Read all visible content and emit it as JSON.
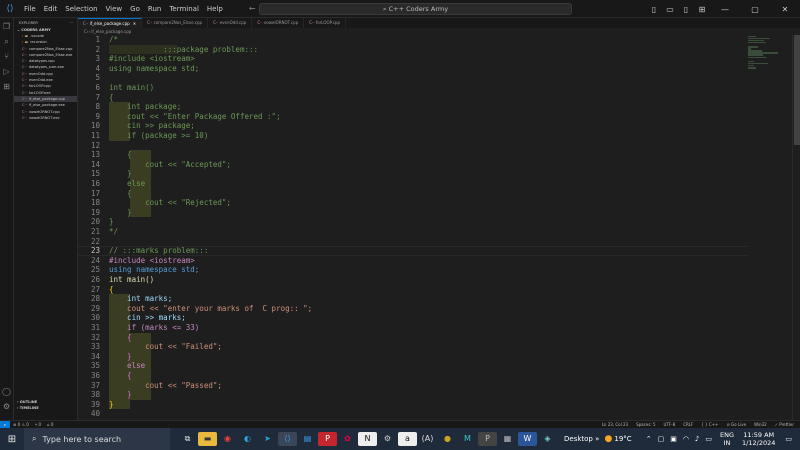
{
  "window": {
    "title": "C++ Coders Army",
    "menu": [
      "File",
      "Edit",
      "Selection",
      "View",
      "Go",
      "Run",
      "Terminal",
      "Help"
    ]
  },
  "sidebar": {
    "header": "EXPLORER",
    "folder": "CODERS ARMY",
    "items": [
      {
        "label": ".vscode",
        "type": "dir"
      },
      {
        "label": "recursion",
        "type": "dir"
      },
      {
        "label": "compare2Nos_Elsse.cpp",
        "type": "file"
      },
      {
        "label": "compare2Nos_Elsse.exe",
        "type": "file"
      },
      {
        "label": "datatypes.cpp",
        "type": "file"
      },
      {
        "label": "datatypes_sum.exe",
        "type": "file"
      },
      {
        "label": "evenOdd.cpp",
        "type": "file"
      },
      {
        "label": "evenOdd.exe",
        "type": "file"
      },
      {
        "label": "forLOOP.cpp",
        "type": "file"
      },
      {
        "label": "forLOOP.exe",
        "type": "file"
      },
      {
        "label": "if_else_package.cpp",
        "type": "file",
        "selected": true
      },
      {
        "label": "if_else_package.exe",
        "type": "file"
      },
      {
        "label": "vowelORNOT.cpp",
        "type": "file"
      },
      {
        "label": "vowelORNOT.exe",
        "type": "file"
      }
    ],
    "bottom": [
      "OUTLINE",
      "TIMELINE"
    ]
  },
  "tabs": [
    {
      "label": "if_else_package.cpp",
      "active": true
    },
    {
      "label": "compare2Nos_Elsse.cpp",
      "active": false
    },
    {
      "label": "evenOdd.cpp",
      "active": false
    },
    {
      "label": "vowelORNOT.cpp",
      "active": false
    },
    {
      "label": "forLOOP.cpp",
      "active": false
    }
  ],
  "breadcrumb": "if_else_package.cpp",
  "editor": {
    "current_line": 23,
    "lines": [
      {
        "n": 1,
        "t": "/*",
        "c": "#6a9955"
      },
      {
        "n": 2,
        "t": "            :::package problem:::",
        "c": "#6a9955"
      },
      {
        "n": 3,
        "t": "#include <iostream>",
        "c": "#6a9955"
      },
      {
        "n": 4,
        "t": "using namespace std;",
        "c": "#6a9955"
      },
      {
        "n": 5,
        "t": "",
        "c": "#6a9955"
      },
      {
        "n": 6,
        "t": "int main()",
        "c": "#6a9955"
      },
      {
        "n": 7,
        "t": "{",
        "c": "#6a9955"
      },
      {
        "n": 8,
        "t": "    int package;",
        "c": "#6a9955"
      },
      {
        "n": 9,
        "t": "    cout << \"Enter Package Offered :\";",
        "c": "#6a9955"
      },
      {
        "n": 10,
        "t": "    cin >> package;",
        "c": "#6a9955"
      },
      {
        "n": 11,
        "t": "    if (package >= 10)",
        "c": "#6a9955"
      },
      {
        "n": 12,
        "t": "",
        "c": "#6a9955"
      },
      {
        "n": 13,
        "t": "    {",
        "c": "#6a9955"
      },
      {
        "n": 14,
        "t": "        cout << \"Accepted\";",
        "c": "#6a9955"
      },
      {
        "n": 15,
        "t": "    }",
        "c": "#6a9955"
      },
      {
        "n": 16,
        "t": "    else",
        "c": "#6a9955"
      },
      {
        "n": 17,
        "t": "    {",
        "c": "#6a9955"
      },
      {
        "n": 18,
        "t": "        cout << \"Rejected\";",
        "c": "#6a9955"
      },
      {
        "n": 19,
        "t": "    }",
        "c": "#6a9955"
      },
      {
        "n": 20,
        "t": "}",
        "c": "#6a9955"
      },
      {
        "n": 21,
        "t": "*/",
        "c": "#6a9955"
      },
      {
        "n": 22,
        "t": "",
        "c": "#6a9955"
      },
      {
        "n": 23,
        "t": "// :::marks problem:::",
        "c": "#6a9955"
      },
      {
        "n": 24,
        "t": "#include <iostream>",
        "c": "#c586c0"
      },
      {
        "n": 25,
        "t": "using namespace std;",
        "c": "#569cd6"
      },
      {
        "n": 26,
        "t": "int main()",
        "c": "#dcdcaa"
      },
      {
        "n": 27,
        "t": "{",
        "c": "#ffd700"
      },
      {
        "n": 28,
        "t": "    int marks;",
        "c": "#9cdcfe"
      },
      {
        "n": 29,
        "t": "    cout << \"enter your marks of  C prog:: \";",
        "c": "#ce9178"
      },
      {
        "n": 30,
        "t": "    cin >> marks;",
        "c": "#9cdcfe"
      },
      {
        "n": 31,
        "t": "    if (marks <= 33)",
        "c": "#c586c0"
      },
      {
        "n": 32,
        "t": "    {",
        "c": "#da70d6"
      },
      {
        "n": 33,
        "t": "        cout << \"Failed\";",
        "c": "#ce9178"
      },
      {
        "n": 34,
        "t": "    }",
        "c": "#da70d6"
      },
      {
        "n": 35,
        "t": "    else",
        "c": "#c586c0"
      },
      {
        "n": 36,
        "t": "    {",
        "c": "#da70d6"
      },
      {
        "n": 37,
        "t": "        cout << \"Passed\";",
        "c": "#ce9178"
      },
      {
        "n": 38,
        "t": "    }",
        "c": "#da70d6"
      },
      {
        "n": 39,
        "t": "}",
        "c": "#ffd700"
      },
      {
        "n": 40,
        "t": "",
        "c": "#cccccc"
      }
    ]
  },
  "status": {
    "left": [
      "⊗ 0 ⚠ 0",
      "⑂ 0",
      "⌂ 0"
    ],
    "right": [
      "Ln 23, Col 23",
      "Spaces: 5",
      "UTF-8",
      "CRLF",
      "{ } C++",
      "⊘ Go Live",
      "Win32",
      "✓ Prettier"
    ]
  },
  "taskbar": {
    "search_placeholder": "Type here to search",
    "desktop_label": "Desktop",
    "weather": "19°C",
    "lang": "ENG",
    "region": "IN",
    "time": "11:59 AM",
    "date": "1/12/2024"
  }
}
